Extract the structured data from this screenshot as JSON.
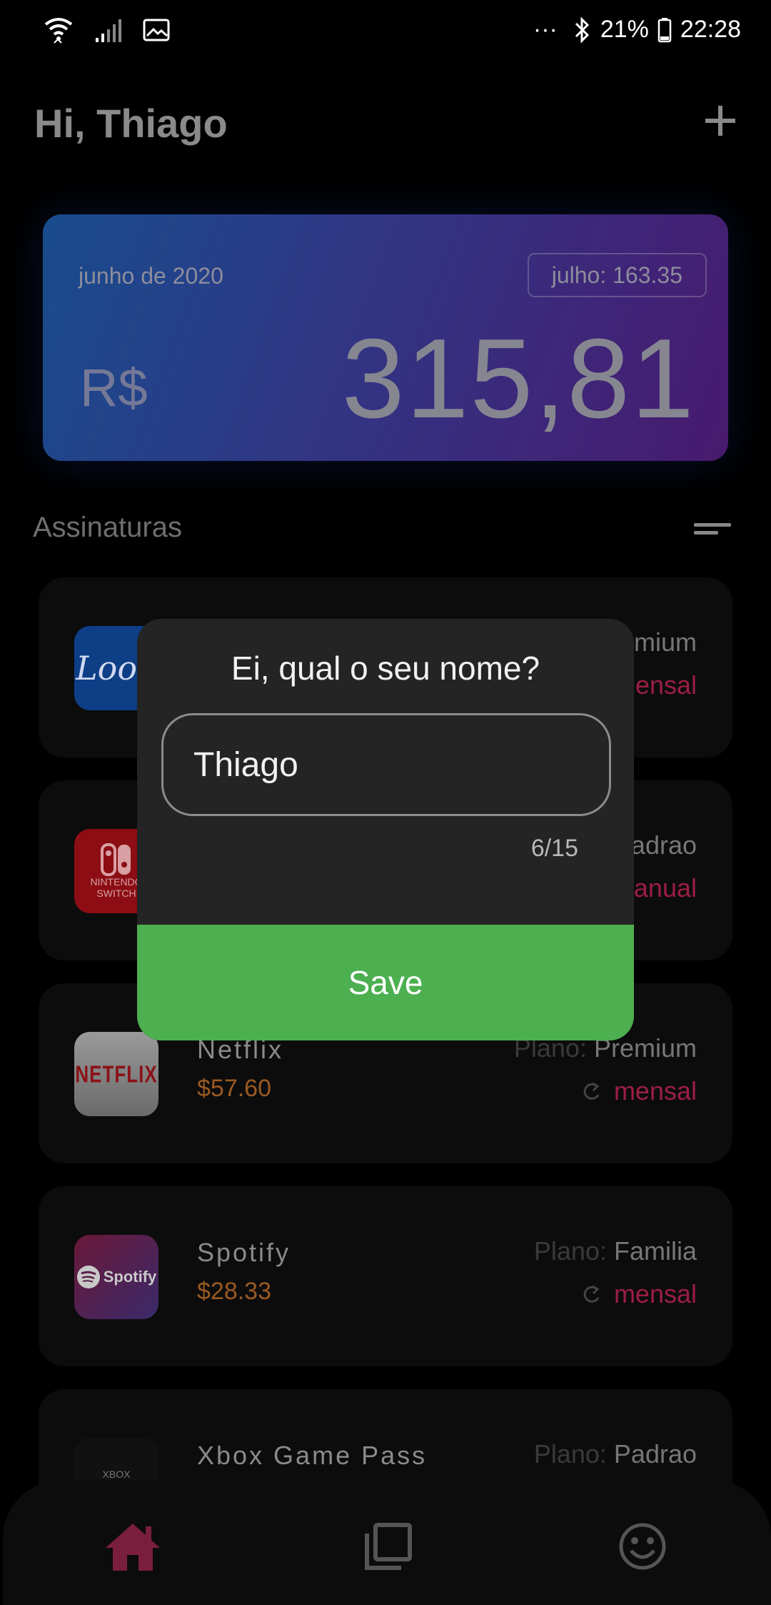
{
  "status_bar": {
    "icons_left": [
      "wifi-icon",
      "signal-icon",
      "gallery-icon"
    ],
    "dots": "···",
    "battery": "21%",
    "time": "22:28"
  },
  "header": {
    "greeting": "Hi, Thiago",
    "add_icon": "plus-icon"
  },
  "summary": {
    "month": "junho de 2020",
    "next_month_chip": "julho:  163.35",
    "currency": "R$",
    "total": "315,81"
  },
  "section_title": "Assinaturas",
  "subscriptions": [
    {
      "logo_text": "Look",
      "name": "",
      "price": "",
      "plan_label": "",
      "plan_value": "Premium",
      "cycle": "mensal",
      "visible_plan": "mium",
      "visible_cycle": "ensal"
    },
    {
      "logo_text": "NINTENDO SWITCH",
      "name": "",
      "price": "",
      "plan_label": "",
      "plan_value": "Padrao",
      "cycle": "anual",
      "visible_plan": "adrao",
      "visible_cycle": "anual"
    },
    {
      "logo_text": "NETFLIX",
      "name": "Netflix",
      "price": "$57.60",
      "plan_label": "Plano:",
      "plan_value": "Premium",
      "cycle": "mensal"
    },
    {
      "logo_text": "Spotify",
      "name": "Spotify",
      "price": "$28.33",
      "plan_label": "Plano:",
      "plan_value": "Familia",
      "cycle": "mensal"
    },
    {
      "logo_text": "XBOX GAME",
      "name": "Xbox Game Pass",
      "price": "",
      "plan_label": "Plano:",
      "plan_value": "Padrao",
      "cycle": ""
    }
  ],
  "dialog": {
    "title": "Ei, qual o seu nome?",
    "input_value": "Thiago",
    "counter": "6/15",
    "save_label": "Save"
  },
  "bottom_nav": [
    "home-icon",
    "copy-icon",
    "smiley-icon"
  ],
  "colors": {
    "accent_save": "#4caf50",
    "cycle_red": "#9c1e45",
    "price_orange": "#9a5a22",
    "nav_active": "#7a1e3e"
  }
}
